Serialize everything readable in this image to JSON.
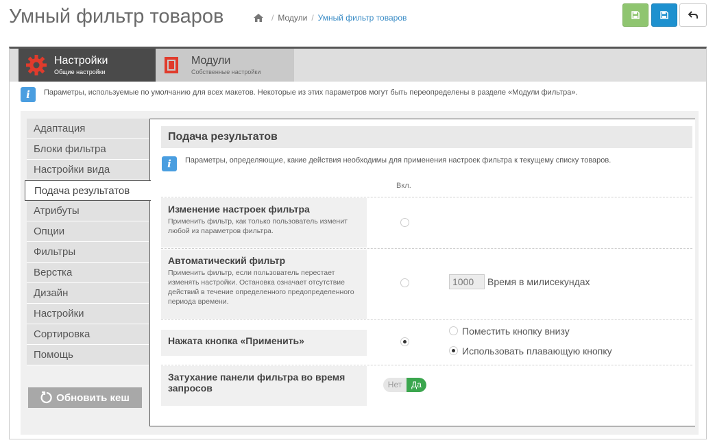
{
  "page": {
    "title": "Умный фильтр товаров",
    "breadcrumb": [
      "Модули",
      "Умный фильтр товаров"
    ]
  },
  "toolbar": {
    "save_icon": "save-icon",
    "save_stay_icon": "save-icon",
    "back_icon": "back-arrow-icon",
    "colors": {
      "green": "#8fc570",
      "blue": "#1e91cf"
    }
  },
  "tabs": [
    {
      "title": "Настройки",
      "subtitle": "Общие настройки",
      "icon": "gear-icon",
      "active": true
    },
    {
      "title": "Модули",
      "subtitle": "Собственные настройки",
      "icon": "module-icon",
      "active": false
    }
  ],
  "info_main": "Параметры, используемые по умолчанию для всех макетов. Некоторые из этих параметров могут быть переопределены в разделе «Модули фильтра».",
  "sidebar": {
    "items": [
      "Адаптация",
      "Блоки фильтра",
      "Настройки вида",
      "Подача результатов",
      "Атрибуты",
      "Опции",
      "Фильтры",
      "Верстка",
      "Дизайн",
      "Настройки",
      "Сортировка",
      "Помощь"
    ],
    "active_index": 3,
    "refresh_label": "Обновить кеш"
  },
  "section": {
    "title": "Подача результатов",
    "info": "Параметры, определяющие, какие действия необходимы для применения настроек фильтра к текущему списку товаров.",
    "column_header": "Вкл.",
    "rows": [
      {
        "title": "Изменение настроек фильтра",
        "desc": "Применить фильтр, как только пользователь изменит любой из параметров фильтра.",
        "checked": false
      },
      {
        "title": "Автоматический фильтр",
        "desc": "Применить фильтр, если пользователь перестает изменять настройки. Остановка означает отсутствие действий в течение определенного предопределенного периода времени.",
        "checked": false,
        "delay_value": "1000",
        "delay_label": "Время в милисекундах"
      },
      {
        "title": "Нажата кнопка «Применить»",
        "checked": true,
        "options": [
          {
            "label": "Поместить кнопку внизу",
            "checked": false
          },
          {
            "label": "Использовать плавающую кнопку",
            "checked": true
          }
        ]
      },
      {
        "title": "Затухание панели фильтра во время запросов",
        "toggle_off": "Нет",
        "toggle_on": "Да",
        "value": true
      }
    ]
  }
}
